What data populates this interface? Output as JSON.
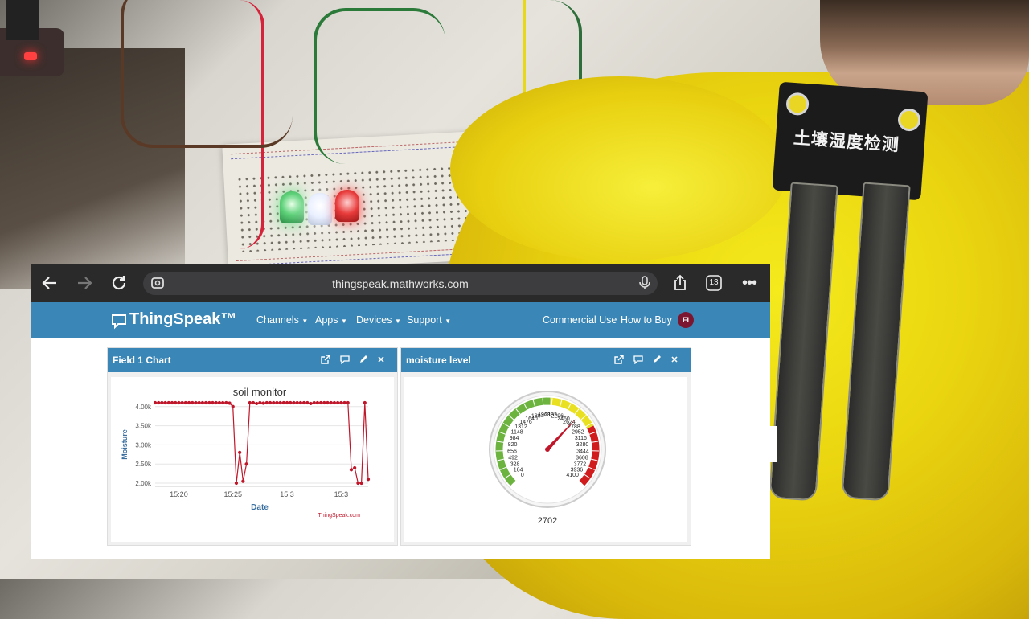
{
  "browser": {
    "url": "thingspeak.mathworks.com",
    "tab_count": "13",
    "icons": {
      "back": "arrow-left-icon",
      "forward": "arrow-right-icon",
      "reload": "reload-icon",
      "site_settings": "site-settings-icon",
      "mic": "microphone-icon",
      "share": "share-icon",
      "tabs": "tabs-icon",
      "more": "more-icon"
    }
  },
  "site": {
    "brand": "ThingSpeak™",
    "nav": [
      "Channels",
      "Apps",
      "Devices",
      "Support"
    ],
    "right_nav": [
      "Commercial Use",
      "How to Buy"
    ],
    "avatar_initials": "FI",
    "brand_color": "#3a87b7"
  },
  "photo": {
    "sensor_label": "土壤湿度检测"
  },
  "panels": [
    {
      "title": "Field 1 Chart",
      "icons": [
        "open-external-icon",
        "comment-icon",
        "edit-icon",
        "close-icon"
      ]
    },
    {
      "title": "moisture level",
      "icons": [
        "open-external-icon",
        "comment-icon",
        "edit-icon",
        "close-icon"
      ]
    }
  ],
  "chart_data": {
    "type": "line",
    "title": "soil monitor",
    "xlabel": "Date",
    "ylabel": "Moisture",
    "x_ticks": [
      "15:20",
      "15:25",
      "15:3",
      "15:3"
    ],
    "y_ticks": [
      "2.00k",
      "2.50k",
      "3.00k",
      "3.50k",
      "4.00k"
    ],
    "ylim": [
      2000,
      4100
    ],
    "series": [
      {
        "color": "#c0162a",
        "x": [
          0,
          1,
          2,
          3,
          4,
          5,
          6,
          7,
          8,
          9,
          10,
          11,
          12,
          13,
          14,
          15,
          16,
          17,
          18,
          19,
          20,
          21,
          22,
          23,
          24,
          25,
          26,
          27,
          28,
          29,
          30,
          31,
          32,
          33,
          34,
          35,
          36,
          37,
          38,
          39,
          40,
          41,
          42,
          43,
          44,
          45,
          46,
          47,
          48,
          49,
          50,
          51,
          52,
          53,
          54,
          55,
          56,
          57,
          58,
          59,
          60,
          61,
          62,
          63
        ],
        "y": [
          4100,
          4100,
          4100,
          4100,
          4100,
          4100,
          4100,
          4100,
          4100,
          4100,
          4100,
          4100,
          4100,
          4100,
          4100,
          4100,
          4100,
          4100,
          4100,
          4100,
          4100,
          4100,
          4090,
          4000,
          2000,
          2800,
          2050,
          2500,
          4100,
          4100,
          4080,
          4100,
          4090,
          4100,
          4100,
          4100,
          4100,
          4100,
          4100,
          4100,
          4100,
          4100,
          4100,
          4100,
          4100,
          4100,
          4080,
          4100,
          4100,
          4100,
          4100,
          4100,
          4100,
          4100,
          4100,
          4100,
          4100,
          4100,
          2350,
          2400,
          2000,
          2000,
          4100,
          2100
        ]
      }
    ],
    "watermark": "ThingSpeak.com"
  },
  "gauge": {
    "value": "2702",
    "min": 0,
    "max": 4100,
    "needle_value": 2702,
    "colors": {
      "green": "#6cb33f",
      "yellow": "#e8e020",
      "red": "#d01c1c"
    }
  }
}
